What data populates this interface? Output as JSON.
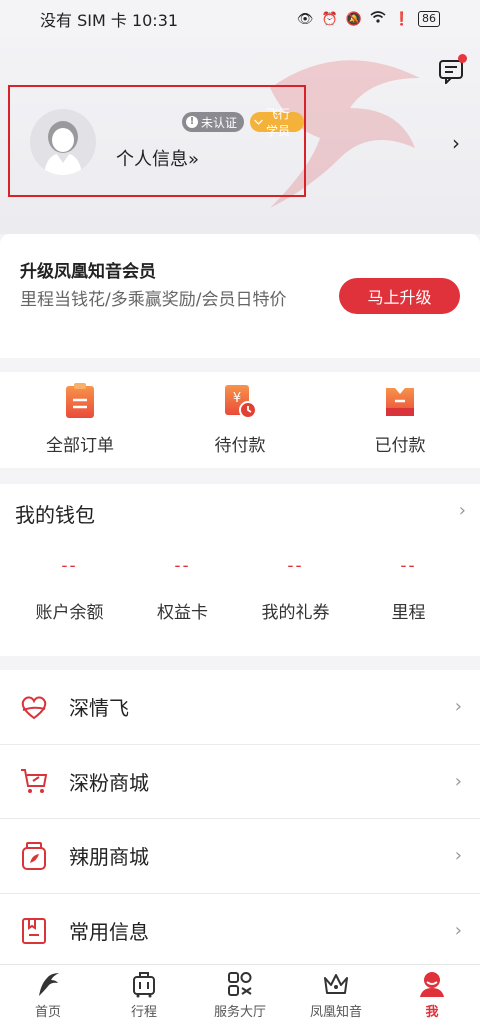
{
  "status_bar": {
    "carrier_time": "没有 SIM 卡 10:31",
    "battery": "86"
  },
  "profile": {
    "link_text": "个人信息»",
    "badge_unverified": "未认证",
    "badge_level": "飞行学员"
  },
  "upgrade": {
    "title": "升级凤凰知音会员",
    "description": "里程当钱花/多乘赢奖励/会员日特价",
    "button": "马上升级"
  },
  "orders": [
    {
      "label": "全部订单",
      "icon": "clipboard-icon"
    },
    {
      "label": "待付款",
      "icon": "payment-pending-icon"
    },
    {
      "label": "已付款",
      "icon": "paid-icon"
    }
  ],
  "wallet": {
    "title": "我的钱包",
    "items": [
      {
        "value": "--",
        "label": "账户余额"
      },
      {
        "value": "--",
        "label": "权益卡"
      },
      {
        "value": "--",
        "label": "我的礼券"
      },
      {
        "value": "--",
        "label": "里程"
      }
    ]
  },
  "menu": [
    {
      "label": "深情飞",
      "icon": "heart-icon"
    },
    {
      "label": "深粉商城",
      "icon": "shopping-cart-icon"
    },
    {
      "label": "辣朋商城",
      "icon": "jar-icon"
    },
    {
      "label": "常用信息",
      "icon": "bookmark-icon"
    }
  ],
  "tabs": [
    {
      "label": "首页",
      "icon": "phoenix-icon"
    },
    {
      "label": "行程",
      "icon": "luggage-icon"
    },
    {
      "label": "服务大厅",
      "icon": "services-icon"
    },
    {
      "label": "凤凰知音",
      "icon": "crown-icon"
    },
    {
      "label": "我",
      "icon": "user-icon",
      "active": true
    }
  ],
  "colors": {
    "accent": "#e0323b",
    "badge_gold": "#f4b23a",
    "badge_gray": "#8a8a90"
  }
}
